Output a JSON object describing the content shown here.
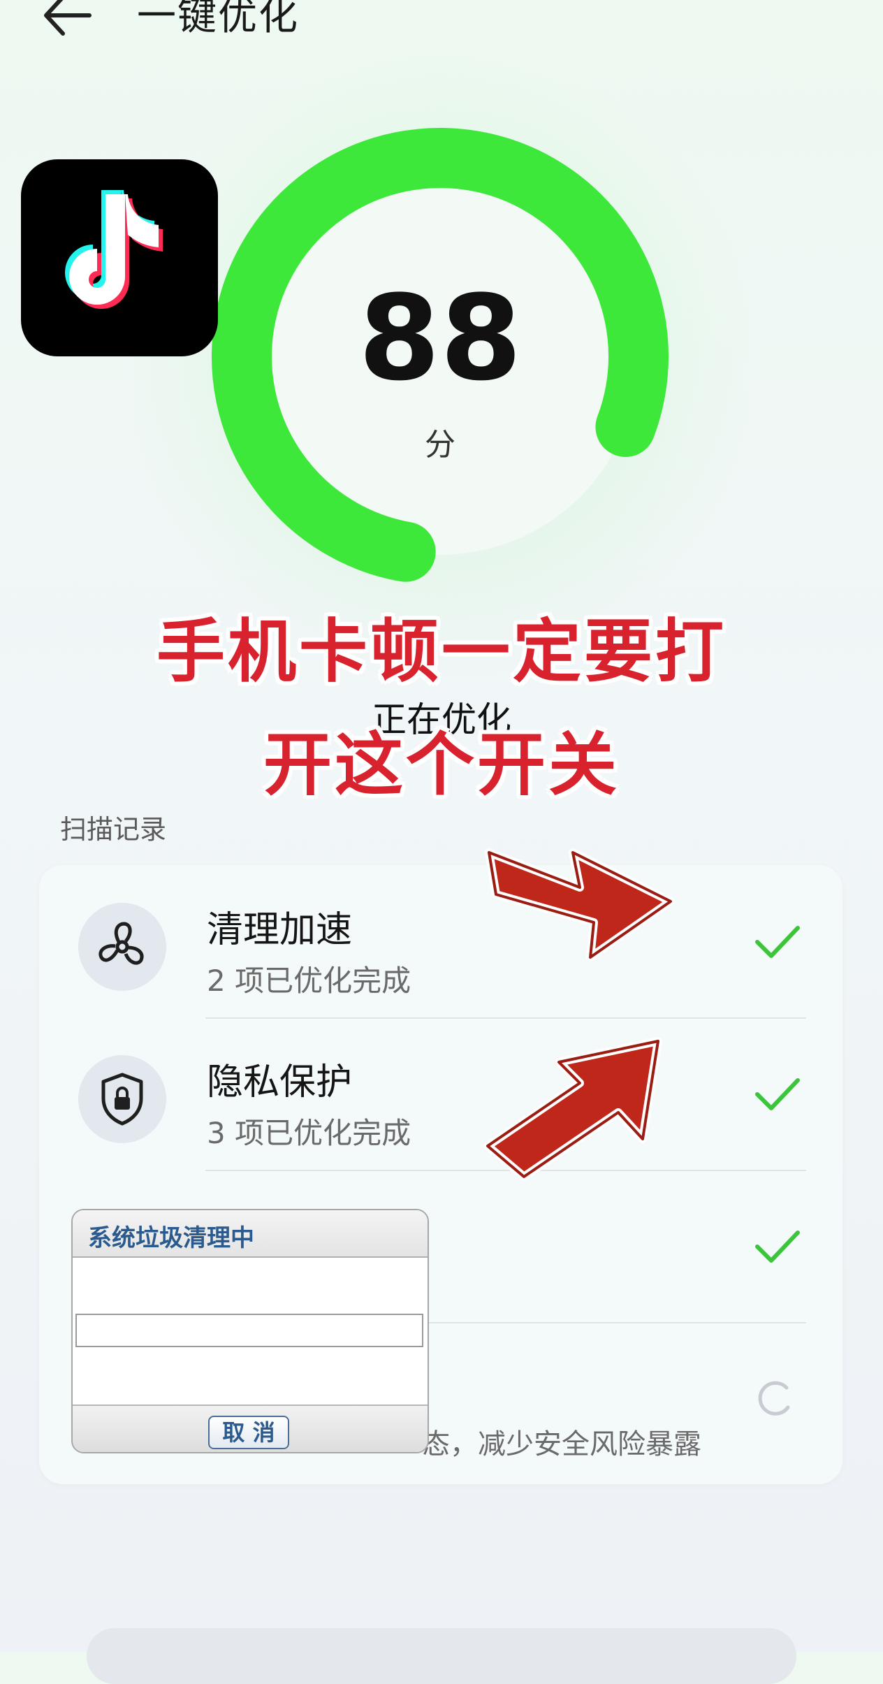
{
  "header": {
    "title": "一键优化",
    "back_icon": "arrow-left-icon"
  },
  "logo": {
    "name": "tiktok-logo-icon"
  },
  "score": {
    "value": "88",
    "unit": "分",
    "ring_fraction": 0.78,
    "ring_color": "#3de83a"
  },
  "overlay": {
    "line1": "手机卡顿一定要打",
    "line2": "开这个开关",
    "color": "#d8232e"
  },
  "status_text": "正在优化",
  "scan": {
    "section_label": "扫描记录",
    "rows": [
      {
        "icon": "fan-icon",
        "title": "清理加速",
        "subtitle": "2 项已优化完成",
        "state": "done"
      },
      {
        "icon": "shield-lock-icon",
        "title": "隐私保护",
        "subtitle": "3 项已优化完成",
        "state": "done"
      },
      {
        "icon": "",
        "title": "",
        "subtitle": "",
        "state": "done"
      },
      {
        "icon": "",
        "title": "",
        "subtitle_tail": "态，减少安全风险暴露",
        "state": "in-progress"
      }
    ]
  },
  "dialog": {
    "title": "系统垃圾清理中",
    "cancel_label": "取 消"
  },
  "colors": {
    "check": "#3cc43a",
    "arrow": "#c0271b"
  }
}
